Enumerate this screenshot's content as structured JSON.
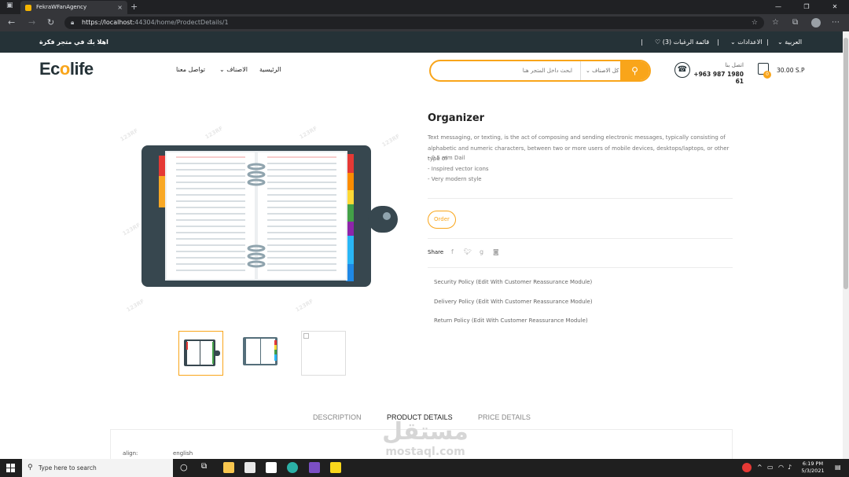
{
  "browser": {
    "tab_title": "FekraWFanAgency",
    "tab_close": "×",
    "new_tab": "+",
    "url_host": "https://localhost:",
    "url_rest": "44304/home/ProdectDetails/1",
    "window_buttons": [
      "—",
      "❐",
      "✕"
    ]
  },
  "topbar": {
    "welcome": "اهلا بك في متجر فكرة",
    "language": "العربية",
    "settings": "الاعدادات",
    "wishlist": "قائمة الرغبات (3)",
    "separator": "|"
  },
  "header": {
    "logo_prefix": "Ec",
    "logo_o": "o",
    "logo_suffix": "life",
    "nav": {
      "home": "الرئيسية",
      "categories": "الاصناف",
      "contact": "تواصل معنا"
    },
    "search_placeholder": "ابحث داخل المتجر هنا",
    "search_category": "كل الاصناف",
    "contact_label": "اتصل بنا",
    "contact_phone": "+963 987 1980 61",
    "cart_count": "0",
    "cart_total": "30.00 S.P"
  },
  "product": {
    "title": "Organizer",
    "description": "Text messaging, or texting, is the act of composing and sending electronic messages, typically consisting of alphabetic and numeric characters, between two or more users of mobile devices, desktops/laptops, or other type of",
    "bullets": [
      "- 0.5 mm Dail",
      "- Inspired vector icons",
      "- Very modern style"
    ],
    "order_button": "Order",
    "share_label": "Share",
    "policies": [
      "Security Policy (Edit With Customer Reassurance Module)",
      "Delivery Policy (Edit With Customer Reassurance Module)",
      "Return Policy (Edit With Customer Reassurance Module)"
    ],
    "image_watermark": "123RF"
  },
  "tabs": {
    "description": "DESCRIPTION",
    "product_details": "PRODUCT DETAILS",
    "price_details": "PRICE DETAILS"
  },
  "details": {
    "align_label": "align:",
    "align_value": "english"
  },
  "watermark": {
    "arabic": "مستقل",
    "latin": "mostaql.com"
  },
  "taskbar": {
    "search_placeholder": "Type here to search",
    "time": "6:19 PM",
    "date": "5/3/2021"
  },
  "colors": {
    "accent": "#f9a51a",
    "dark": "#253237"
  }
}
